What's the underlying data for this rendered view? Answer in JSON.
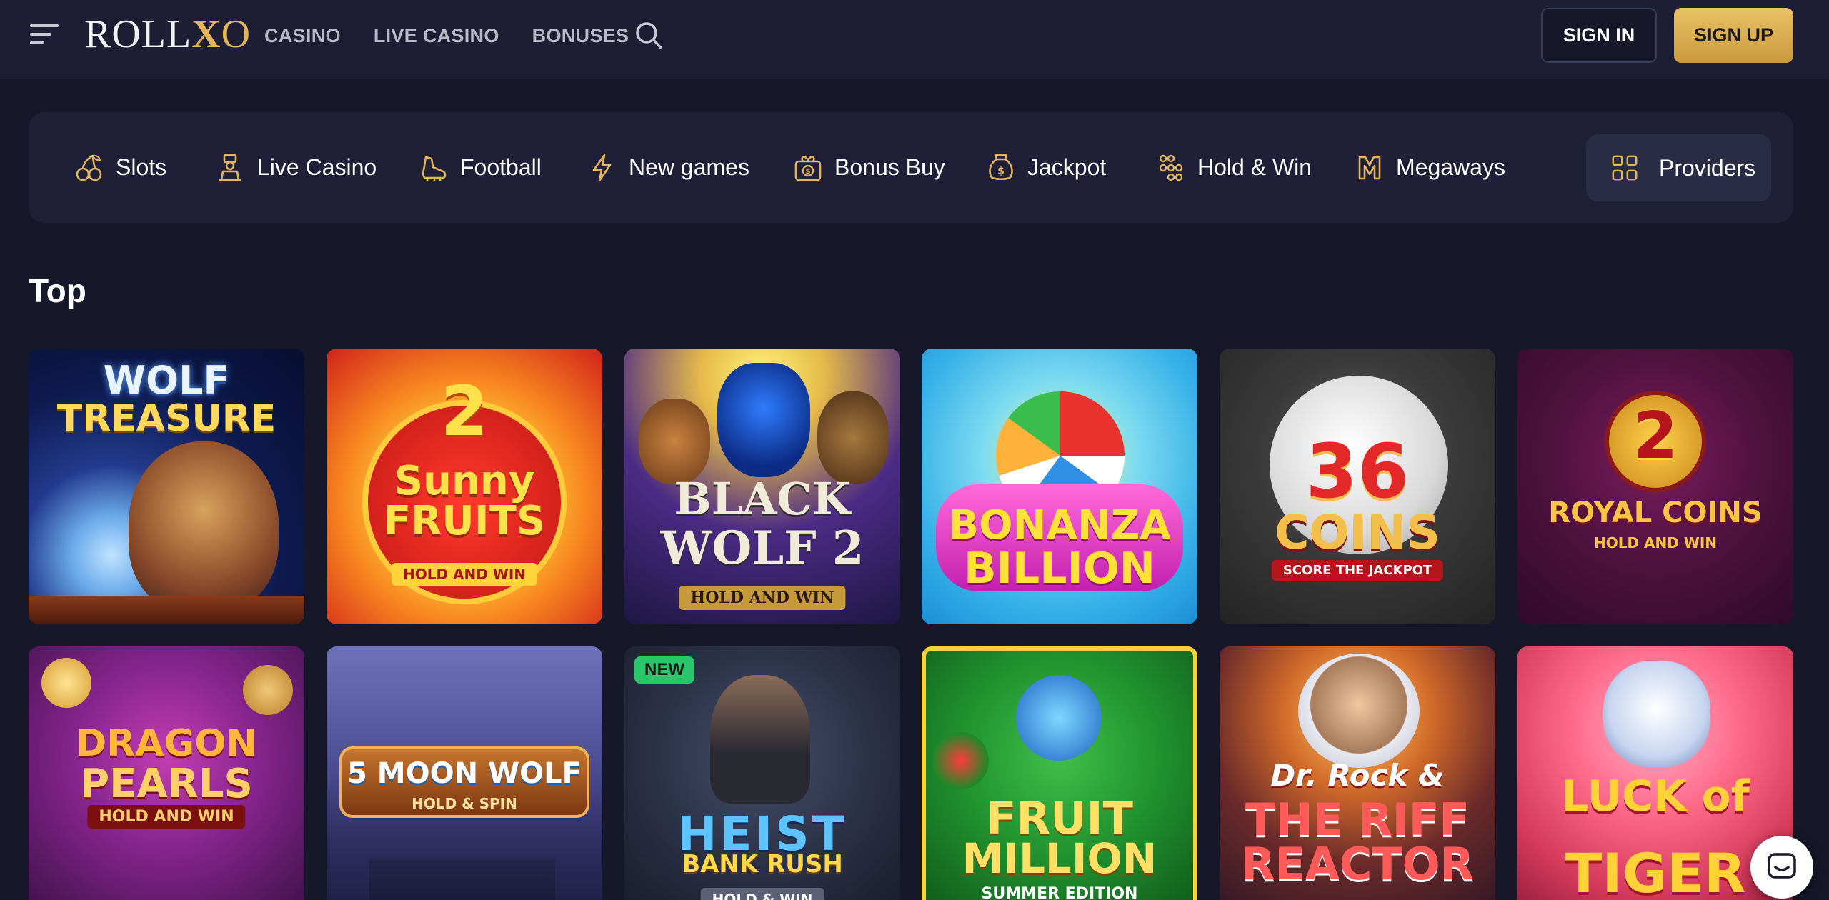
{
  "header": {
    "logo_text": "ROLL",
    "logo_accent": "X",
    "logo_end": "O",
    "nav": [
      "CASINO",
      "LIVE CASINO",
      "BONUSES"
    ],
    "sign_in": "SIGN IN",
    "sign_up": "SIGN UP"
  },
  "categories": [
    {
      "label": "Slots",
      "icon": "cherries-icon"
    },
    {
      "label": "Live Casino",
      "icon": "dealer-icon"
    },
    {
      "label": "Football",
      "icon": "football-boot-icon"
    },
    {
      "label": "New games",
      "icon": "lightning-icon"
    },
    {
      "label": "Bonus Buy",
      "icon": "gift-coin-icon"
    },
    {
      "label": "Jackpot",
      "icon": "money-bag-icon"
    },
    {
      "label": "Hold & Win",
      "icon": "dots-grid-icon"
    },
    {
      "label": "Megaways",
      "icon": "megaways-icon"
    }
  ],
  "providers": {
    "label": "Providers",
    "icon": "grid-icon"
  },
  "section": {
    "title": "Top"
  },
  "games": [
    {
      "line1": "WOLF",
      "line2": "TREASURE",
      "sub": ""
    },
    {
      "line1": "2",
      "line2": "Sunny FRUITS",
      "sub": "HOLD AND WIN"
    },
    {
      "line1": "BLACK",
      "line2": "WOLF 2",
      "sub": "HOLD AND WIN"
    },
    {
      "line1": "BONANZA",
      "line2": "BILLION",
      "sub": ""
    },
    {
      "line1": "36",
      "line2": "COINS",
      "sub": "SCORE THE JACKPOT"
    },
    {
      "line1": "2",
      "line2": "ROYAL COINS",
      "sub": "HOLD AND WIN"
    },
    {
      "line1": "DRAGON",
      "line2": "PEARLS",
      "sub": "HOLD AND WIN"
    },
    {
      "line1": "5 MOON WOLF",
      "line2": "",
      "sub": "HOLD & SPIN"
    },
    {
      "line1": "HEIST",
      "line2": "BANK RUSH",
      "sub": "HOLD & WIN",
      "badge": "NEW"
    },
    {
      "line1": "FRUIT",
      "line2": "MILLION",
      "sub": "SUMMER EDITION"
    },
    {
      "line1": "Dr. Rock &",
      "line2": "THE RIFF REACTOR",
      "sub": ""
    },
    {
      "line1": "LUCK of",
      "line2": "TIGER",
      "sub": ""
    }
  ],
  "colors": {
    "background": "#161729",
    "header": "#1d1e34",
    "gold": "#e3b45a",
    "category_bar": "#1f2038"
  }
}
